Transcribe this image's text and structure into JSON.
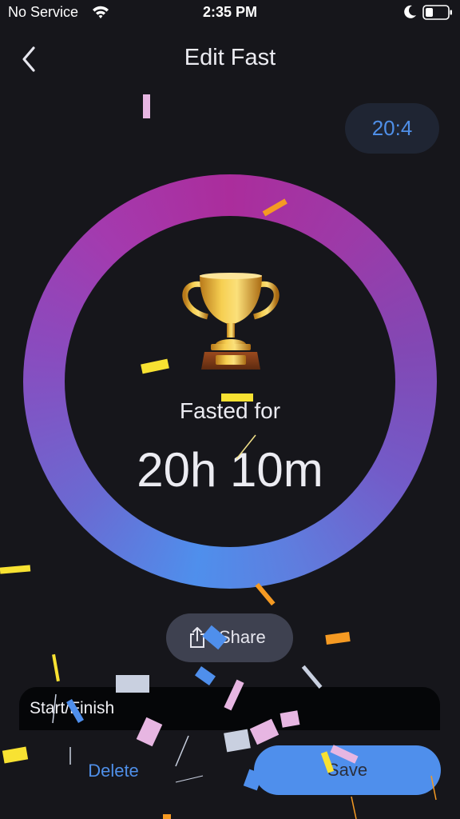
{
  "status_bar": {
    "carrier": "No Service",
    "time": "2:35 PM",
    "icons": [
      "wifi-icon",
      "moon-icon",
      "battery-icon"
    ]
  },
  "header": {
    "title": "Edit Fast",
    "back_icon": "chevron-left-icon"
  },
  "timer_pill": {
    "text": "20:4"
  },
  "progress_ring": {
    "progress": 1.0,
    "colors": [
      "#ab2d9c",
      "#7b50be",
      "#4f8fec"
    ]
  },
  "result": {
    "icon": "trophy-icon",
    "label": "Fasted for",
    "duration": "20h 10m"
  },
  "share": {
    "label": "Share",
    "icon": "share-icon"
  },
  "start_finish": {
    "label": "Start/Finish"
  },
  "actions": {
    "delete_label": "Delete",
    "save_label": "Save"
  },
  "colors": {
    "background": "#16161b",
    "accent": "#4f8fec",
    "pill": "#1f2533",
    "share_button": "#3e4150"
  }
}
